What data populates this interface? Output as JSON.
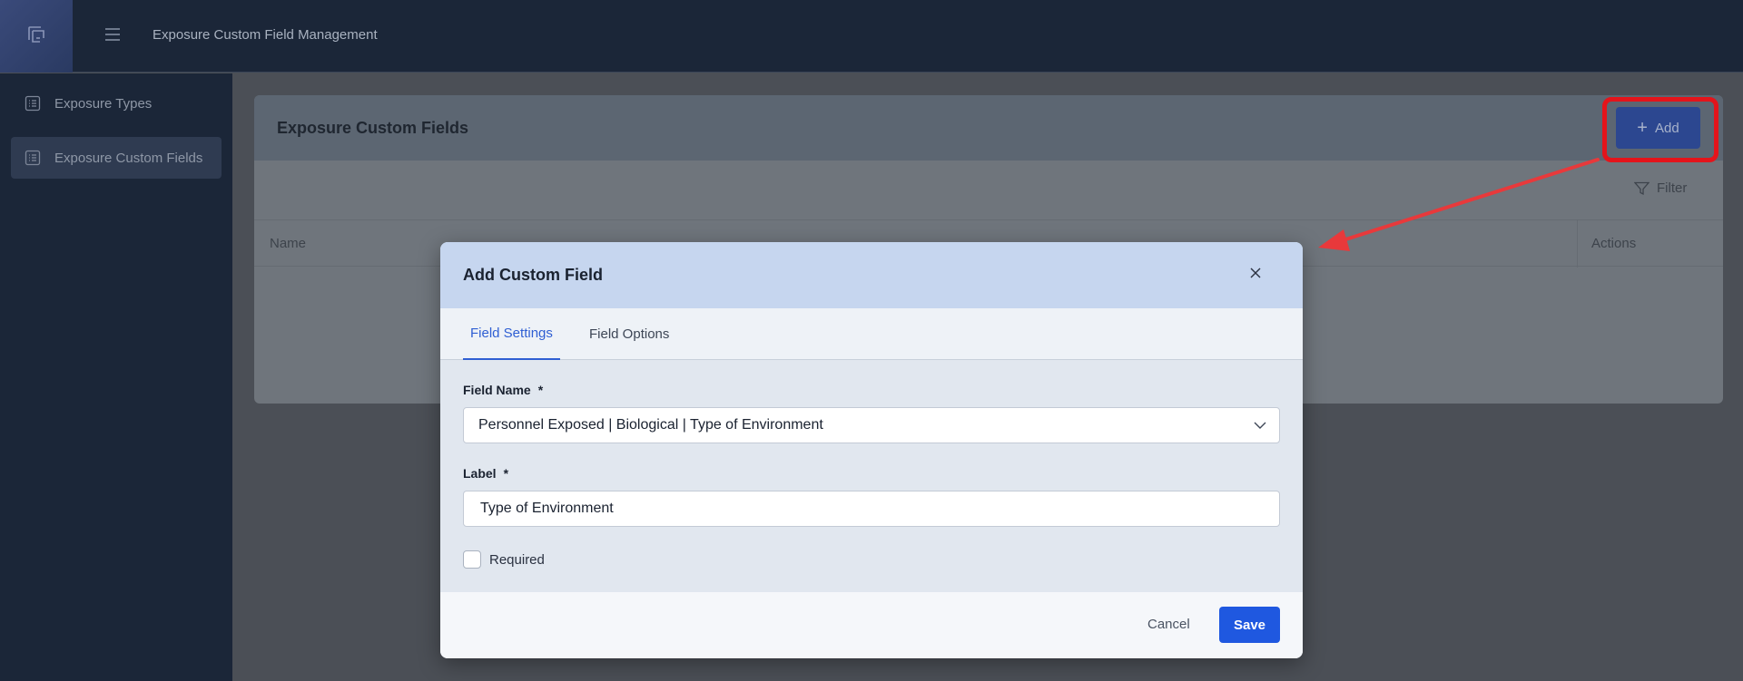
{
  "app": {
    "title": "Exposure Custom Field Management"
  },
  "sidebar": {
    "items": [
      {
        "label": "Exposure Types",
        "icon": "list-icon",
        "active": false
      },
      {
        "label": "Exposure Custom Fields",
        "icon": "list-icon",
        "active": true
      }
    ]
  },
  "main": {
    "title": "Exposure Custom Fields",
    "add_label": "Add",
    "filter_label": "Filter",
    "table": {
      "columns": [
        "Name",
        "Actions"
      ]
    }
  },
  "modal": {
    "title": "Add Custom Field",
    "tabs": [
      {
        "label": "Field Settings",
        "active": true
      },
      {
        "label": "Field Options",
        "active": false
      }
    ],
    "field_name": {
      "label": "Field Name",
      "required_mark": "*",
      "value": "Personnel Exposed | Biological | Type of Environment"
    },
    "label_field": {
      "label": "Label",
      "required_mark": "*",
      "value": "Type of Environment"
    },
    "required_checkbox": {
      "label": "Required",
      "checked": false
    },
    "cancel_label": "Cancel",
    "save_label": "Save"
  },
  "colors": {
    "accent": "#1f58e0",
    "highlight": "#e4141b",
    "topbar": "#1b2638",
    "modal_header": "#c6d6ef"
  }
}
